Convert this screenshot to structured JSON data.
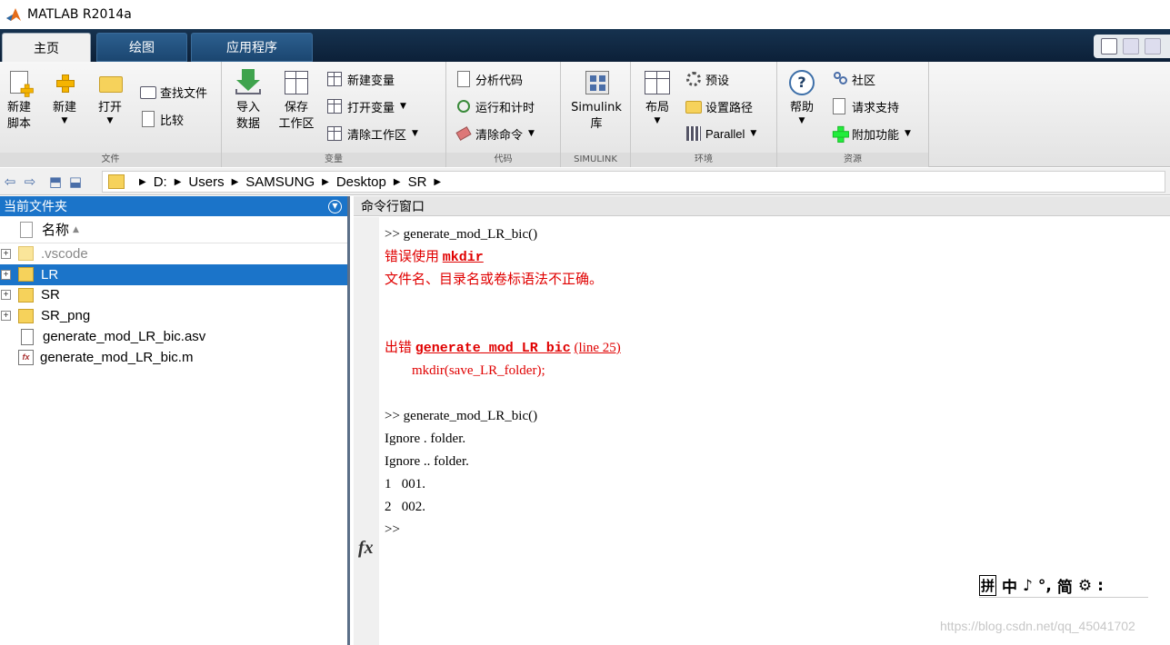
{
  "app": {
    "title": "MATLAB R2014a"
  },
  "ribbon_tabs": [
    {
      "label": "主页",
      "active": true
    },
    {
      "label": "绘图",
      "active": false
    },
    {
      "label": "应用程序",
      "active": false
    }
  ],
  "ribbon": {
    "file": {
      "group_label": "文件",
      "new_script": "新建\n脚本",
      "new": "新建",
      "open": "打开",
      "find_files": "查找文件",
      "compare": "比较"
    },
    "variable": {
      "group_label": "变量",
      "import": "导入\n数据",
      "save": "保存\n工作区",
      "new_var": "新建变量",
      "open_var": "打开变量",
      "clear_ws": "清除工作区"
    },
    "code": {
      "group_label": "代码",
      "analyze": "分析代码",
      "run_time": "运行和计时",
      "clear_cmd": "清除命令"
    },
    "simulink": {
      "group_label": "SIMULINK",
      "library": "Simulink\n库"
    },
    "environment": {
      "group_label": "环境",
      "layout": "布局",
      "prefs": "预设",
      "set_path": "设置路径",
      "parallel": "Parallel"
    },
    "resources": {
      "group_label": "资源",
      "help": "帮助",
      "community": "社区",
      "support": "请求支持",
      "addons": "附加功能"
    }
  },
  "address_bar": {
    "path": [
      "D:",
      "Users",
      "SAMSUNG",
      "Desktop",
      "SR"
    ]
  },
  "current_folder": {
    "title": "当前文件夹",
    "column_name": "名称",
    "items": [
      {
        "name": ".vscode",
        "type": "folder",
        "expandable": true,
        "dimmed": true,
        "selected": false
      },
      {
        "name": "LR",
        "type": "folder",
        "expandable": true,
        "dimmed": false,
        "selected": true
      },
      {
        "name": "SR",
        "type": "folder",
        "expandable": true,
        "dimmed": false,
        "selected": false
      },
      {
        "name": "SR_png",
        "type": "folder",
        "expandable": true,
        "dimmed": false,
        "selected": false
      },
      {
        "name": "generate_mod_LR_bic.asv",
        "type": "file",
        "expandable": false,
        "dimmed": false,
        "selected": false
      },
      {
        "name": "generate_mod_LR_bic.m",
        "type": "mfile",
        "expandable": false,
        "dimmed": false,
        "selected": false
      }
    ]
  },
  "command_window": {
    "title": "命令行窗口",
    "cmd1": ">> generate_mod_LR_bic()",
    "err_prefix": "错误使用 ",
    "err_func": "mkdir",
    "err_msg": "文件名、目录名或卷标语法不正确。",
    "at_prefix": "出错 ",
    "at_func": "generate_mod_LR_bic",
    "at_line": "(line 25)",
    "at_code": "        mkdir(save_LR_folder);",
    "cmd2": ">> generate_mod_LR_bic()",
    "out1": "Ignore . folder.",
    "out2": "Ignore .. folder.",
    "out3": "1   001.",
    "out4": "2   002.",
    "prompt": ">>",
    "fx": "fx"
  },
  "ime_bar": {
    "box": "拼",
    "items": [
      "中",
      "♪",
      "°,",
      "简",
      "⚙",
      ":"
    ]
  },
  "watermark": "https://blog.csdn.net/qq_45041702"
}
